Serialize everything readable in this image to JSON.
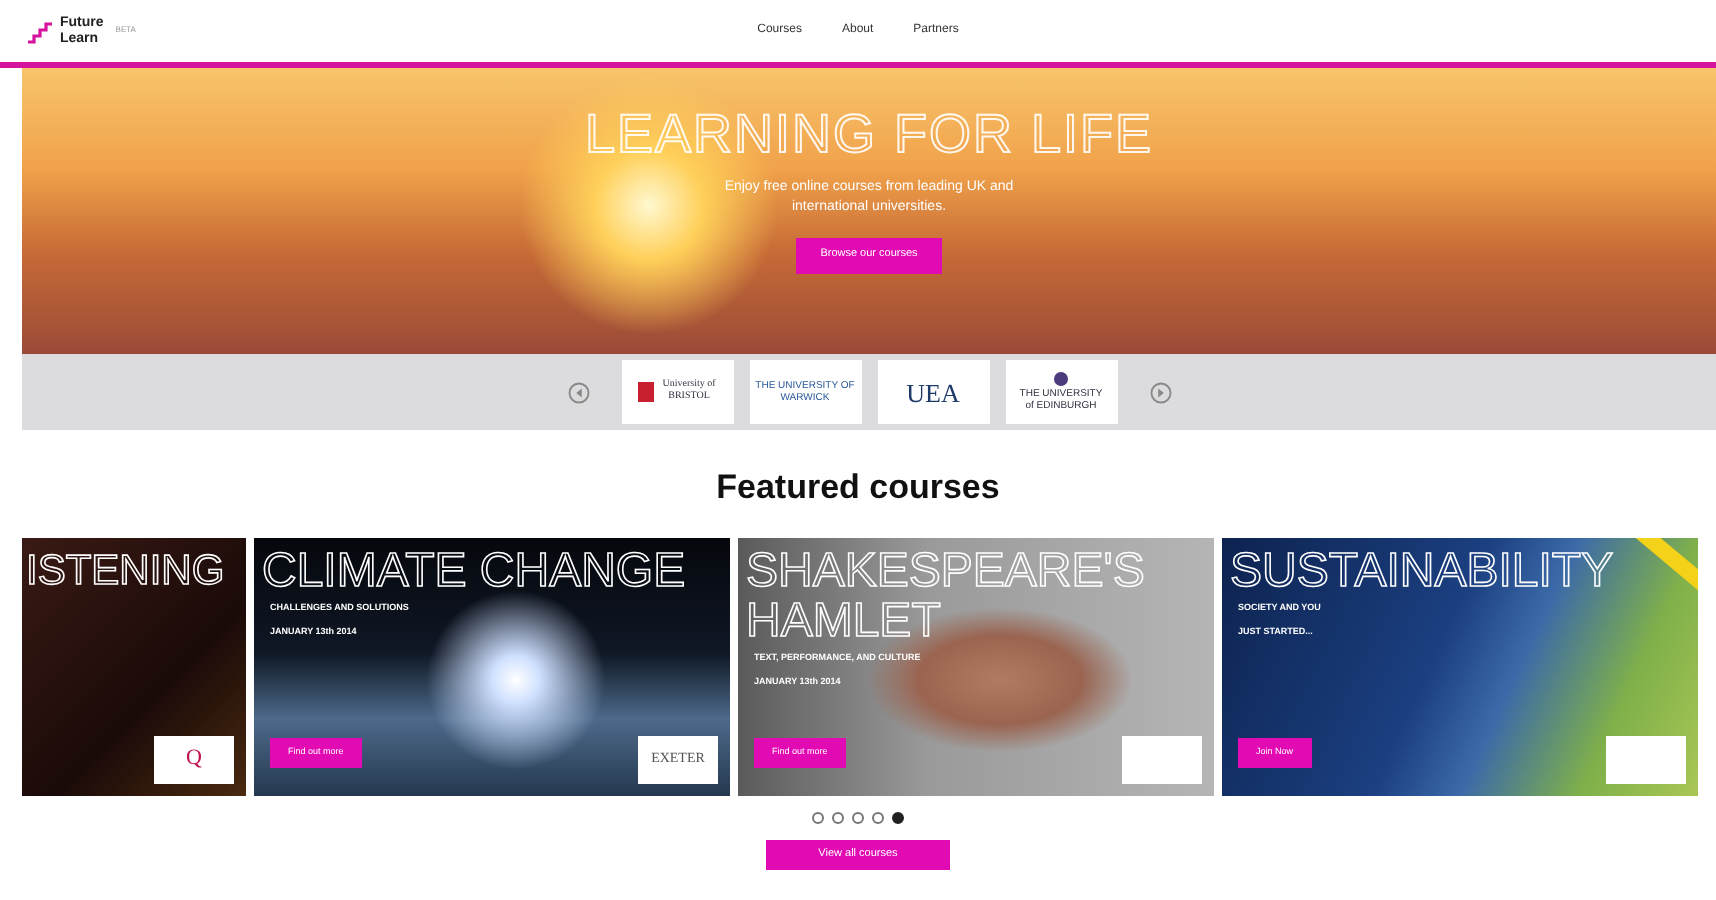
{
  "header": {
    "logo_lines": [
      "Future",
      "Learn"
    ],
    "beta": "BETA",
    "nav": [
      {
        "label": "Courses",
        "selected": false
      },
      {
        "label": "About",
        "selected": false
      },
      {
        "label": "Partners",
        "selected": false
      }
    ]
  },
  "hero": {
    "title": "LEARNING FOR LIFE",
    "text": "Enjoy free online courses from leading UK and international universities.",
    "button": "Browse our courses"
  },
  "partners": [
    {
      "kind": "crest",
      "lines": [
        "University of",
        "BRISTOL"
      ]
    },
    {
      "kind": "plain",
      "lines": [
        "THE UNIVERSITY OF",
        "WARWICK"
      ]
    },
    {
      "kind": "big",
      "lines": [
        "UEA"
      ]
    },
    {
      "kind": "seal",
      "lines": [
        "THE UNIVERSITY",
        "of EDINBURGH"
      ]
    }
  ],
  "featured_title": "Featured courses",
  "courses": [
    {
      "title_lines": [
        "ISTENING"
      ],
      "kind": "stage",
      "logo": "Q",
      "partial": true
    },
    {
      "title_lines": [
        "CLIMATE CHANGE"
      ],
      "subtitle": "CHALLENGES AND SOLUTIONS",
      "date": "JANUARY 13th 2014",
      "button": "Find out more",
      "kind": "earth",
      "logo": "EXETER"
    },
    {
      "title_lines": [
        "SHAKESPEARE'S",
        "HAMLET"
      ],
      "subtitle": "TEXT, PERFORMANCE, AND CULTURE",
      "date": "JANUARY 13th 2014",
      "button": "Find out more",
      "kind": "bust"
    },
    {
      "title_lines": [
        "SUSTAINABILITY"
      ],
      "subtitle": "SOCIETY AND YOU",
      "date": "JUST STARTED...",
      "button": "Join Now",
      "kind": "solar",
      "ribbon": true
    }
  ],
  "slides": [
    {
      "selected": false
    },
    {
      "selected": false
    },
    {
      "selected": false
    },
    {
      "selected": false
    },
    {
      "selected": true
    }
  ],
  "view_all": "View all courses"
}
